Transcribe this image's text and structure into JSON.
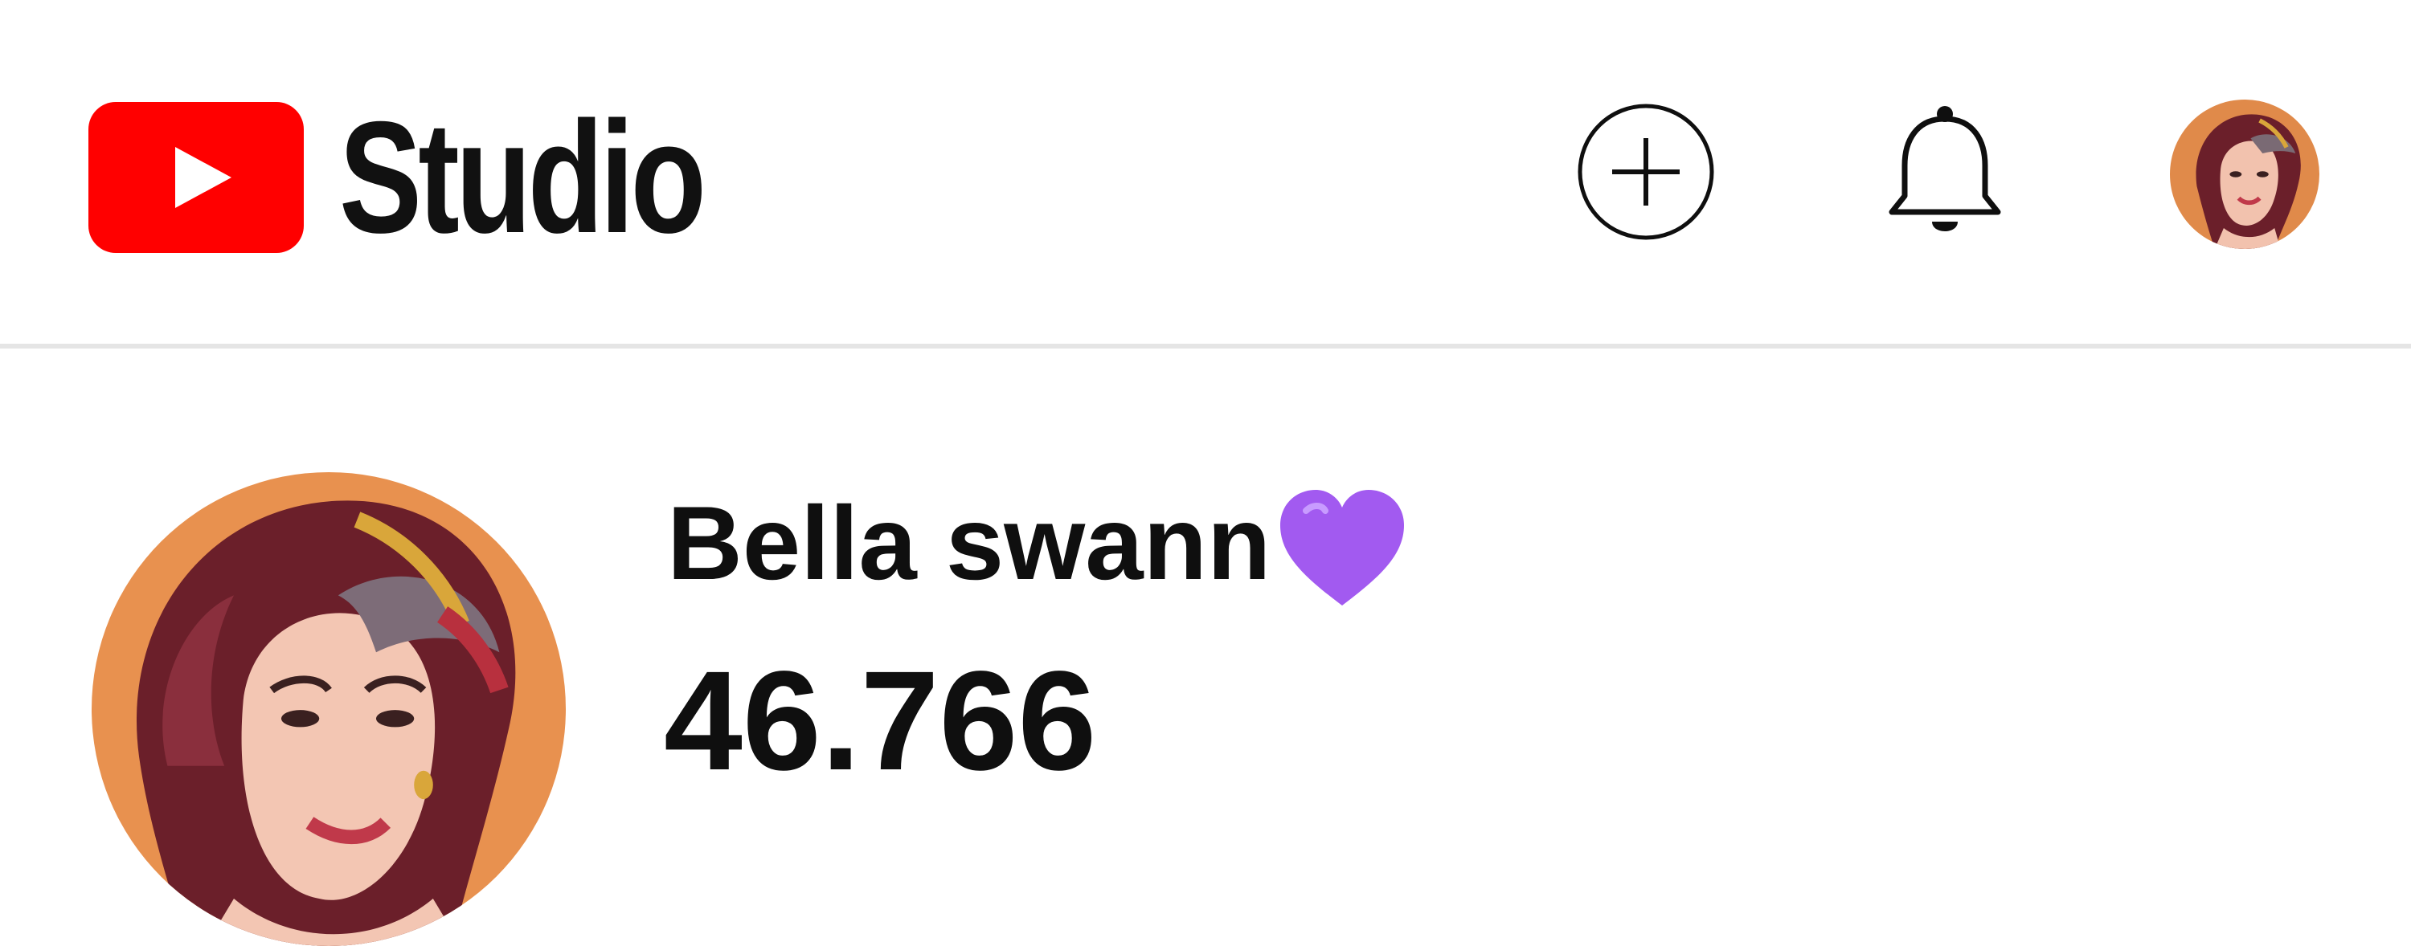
{
  "header": {
    "app_name": "Studio",
    "logo_icon": "youtube-play-icon",
    "create_icon": "plus-circle-icon",
    "notifications_icon": "bell-icon",
    "brand_color": "#ff0000"
  },
  "channel": {
    "name": "Bella swann",
    "name_emoji_icon": "purple-heart-icon",
    "subscriber_count": "46.766"
  }
}
